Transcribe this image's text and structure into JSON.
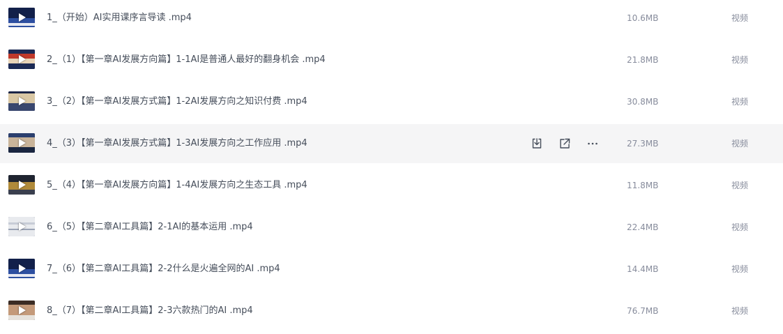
{
  "colors": {
    "text_primary": "#454d5a",
    "text_secondary": "#878c9c",
    "row_hover_bg": "#f5f5f6",
    "icon": "#454d5a"
  },
  "files": [
    {
      "name": "1_（开始）AI实用课序言导读 .mp4",
      "size": "10.6MB",
      "type": "视频",
      "thumb": "blue-stage"
    },
    {
      "name": "2_（1）【第一章AI发展方向篇】1-1AI是普通人最好的翻身机会 .mp4",
      "size": "21.8MB",
      "type": "视频",
      "thumb": "portrait-red"
    },
    {
      "name": "3_（2）【第一章AI发展方式篇】1-2AI发展方向之知识付费 .mp4",
      "size": "30.8MB",
      "type": "视频",
      "thumb": "slide-dark"
    },
    {
      "name": "4_（3）【第一章AI发展方式篇】1-3AI发展方向之工作应用 .mp4",
      "size": "27.3MB",
      "type": "视频",
      "thumb": "portrait-blue",
      "hovered": true
    },
    {
      "name": "5_（4）【第一章AI发展方向篇】1-4AI发展方向之生态工具 .mp4",
      "size": "11.8MB",
      "type": "视频",
      "thumb": "dark-gold"
    },
    {
      "name": "6_（5）【第二章AI工具篇】2-1AI的基本运用 .mp4",
      "size": "22.4MB",
      "type": "视频",
      "thumb": "screen-light"
    },
    {
      "name": "7_（6）【第二章AI工具篇】2-2什么是火遍全网的AI .mp4",
      "size": "14.4MB",
      "type": "视频",
      "thumb": "blue-stage"
    },
    {
      "name": "8_（7）【第二章AI工具篇】2-3六款热门的AI .mp4",
      "size": "76.7MB",
      "type": "视频",
      "thumb": "person-brown"
    }
  ],
  "row_actions": [
    {
      "name": "download-icon"
    },
    {
      "name": "share-icon"
    },
    {
      "name": "more-icon"
    }
  ]
}
